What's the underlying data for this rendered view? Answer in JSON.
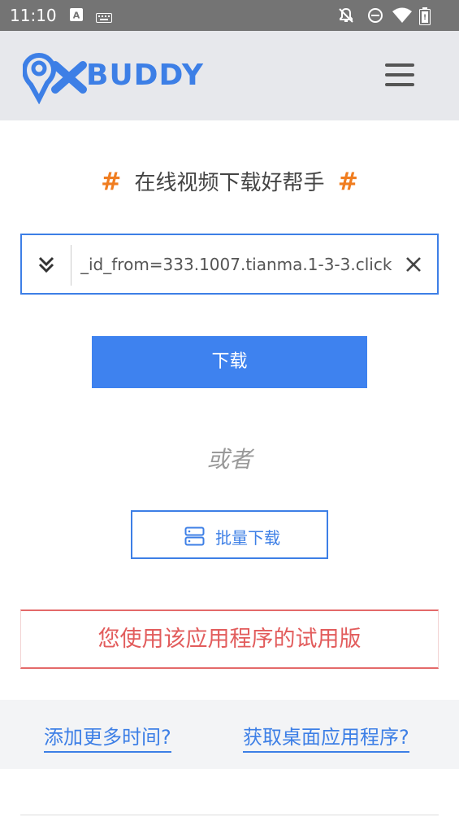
{
  "status_bar": {
    "time": "11:10",
    "icons": [
      "a-notification-icon",
      "keyboard-icon",
      "notifications-off-icon",
      "dnd-icon",
      "wifi-icon",
      "battery-icon"
    ]
  },
  "header": {
    "logo_text": "BUDDY",
    "logo_mark": "9X",
    "menu_icon": "hamburger-icon"
  },
  "main": {
    "headline": "在线视频下载好帮手",
    "hash_symbol": "#",
    "url_input_value": "_id_from=333.1007.tianma.1-3-3.click",
    "download_label": "下载",
    "or_label": "或者",
    "batch_download_label": "批量下载"
  },
  "trial_notice": "您使用该应用程序的试用版",
  "links": {
    "add_time": "添加更多时间?",
    "get_desktop": "获取桌面应用程序?"
  },
  "colors": {
    "brand_blue": "#3d7fe6",
    "accent_orange": "#f07d20",
    "trial_red": "#e25c5c"
  }
}
